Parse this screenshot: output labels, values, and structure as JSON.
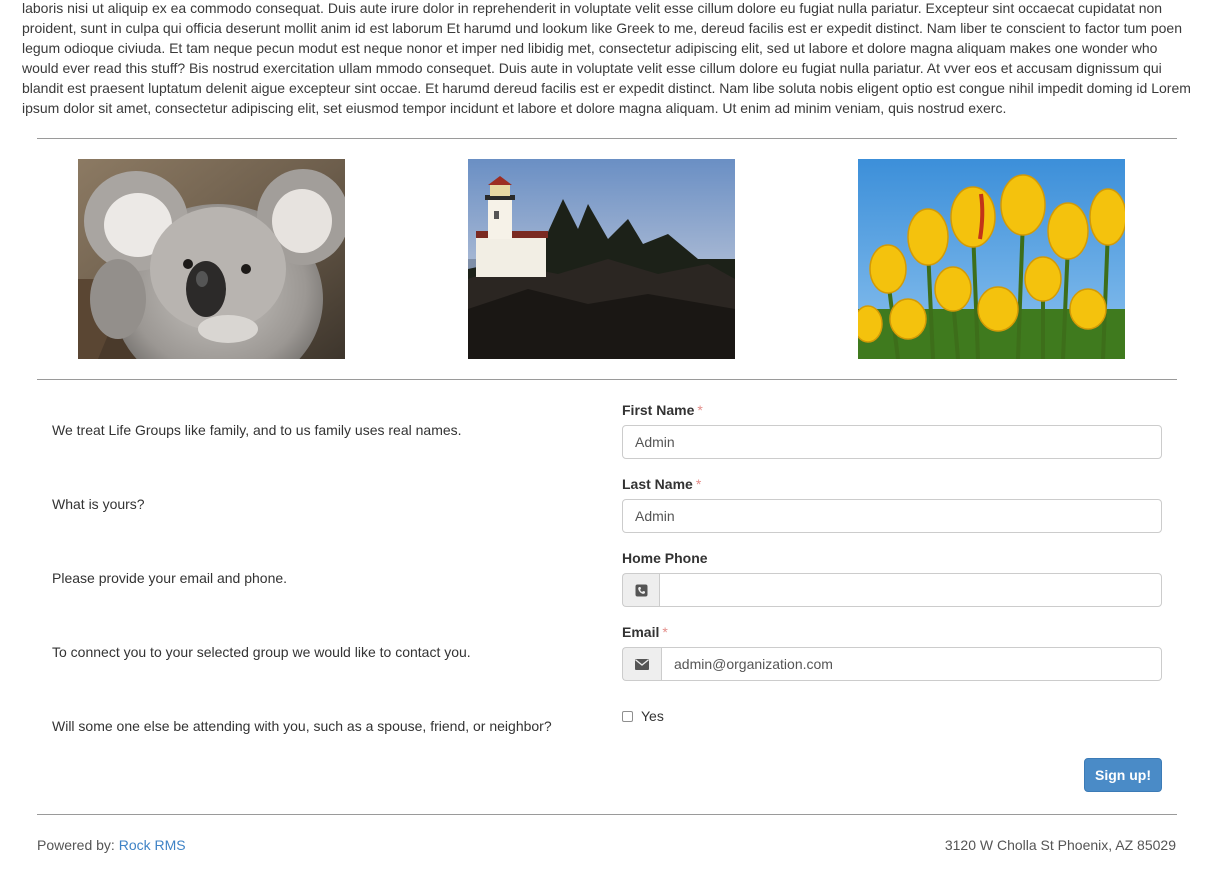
{
  "intro_text": "laboris nisi ut aliquip ex ea commodo consequat. Duis aute irure dolor in reprehenderit in voluptate velit esse cillum dolore eu fugiat nulla pariatur. Excepteur sint occaecat cupidatat non proident, sunt in culpa qui officia deserunt mollit anim id est laborum Et harumd und lookum like Greek to me, dereud facilis est er expedit distinct. Nam liber te conscient to factor tum poen legum odioque civiuda. Et tam neque pecun modut est neque nonor et imper ned libidig met, consectetur adipiscing elit, sed ut labore et dolore magna aliquam makes one wonder who would ever read this stuff? Bis nostrud exercitation ullam mmodo consequet. Duis aute in voluptate velit esse cillum dolore eu fugiat nulla pariatur. At vver eos et accusam dignissum qui blandit est praesent luptatum delenit aigue excepteur sint occae. Et harumd dereud facilis est er expedit distinct. Nam libe soluta nobis eligent optio est congue nihil impedit doming id Lorem ipsum dolor sit amet, consectetur adipiscing elit, set eiusmod tempor incidunt et labore et dolore magna aliquam. Ut enim ad minim veniam, quis nostrud exerc.",
  "photos": [
    "koala-photo",
    "lighthouse-photo",
    "tulips-photo"
  ],
  "prompts": {
    "names": "We treat Life Groups like family, and to us family uses real names.",
    "yours": "What is yours?",
    "contact": "Please provide your email and phone.",
    "connect": "To connect you to your selected group we would like to contact you.",
    "attending": "Will some one else be attending with you, such as a spouse, friend, or neighbor?"
  },
  "form": {
    "first_name": {
      "label": "First Name",
      "required": "*",
      "value": "Admin"
    },
    "last_name": {
      "label": "Last Name",
      "required": "*",
      "value": "Admin"
    },
    "home_phone": {
      "label": "Home Phone",
      "value": "",
      "icon": "phone-icon"
    },
    "email": {
      "label": "Email",
      "required": "*",
      "value": "admin@organization.com",
      "icon": "envelope-icon"
    },
    "attending_checkbox": {
      "label": "Yes",
      "checked": false
    },
    "submit_label": "Sign up!"
  },
  "footer": {
    "powered_by": "Powered by:",
    "link_text": "Rock RMS",
    "address": "3120 W Cholla St Phoenix, AZ 85029"
  },
  "colors": {
    "primary_button": "#4a8bc7",
    "link": "#3f83c6",
    "required_marker": "#e38c88"
  }
}
